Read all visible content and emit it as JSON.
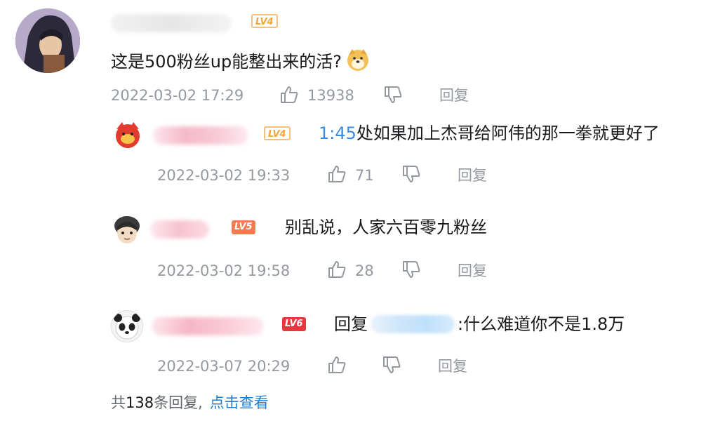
{
  "comment": {
    "level": "LV4",
    "text": "这是500粉丝up能整出来的活?",
    "timestamp": "2022-03-02 17:29",
    "likes": "13938",
    "reply_label": "回复"
  },
  "replies": [
    {
      "level": "LV4",
      "time_link": "1:45",
      "text": "处如果加上杰哥给阿伟的那一拳就更好了",
      "timestamp": "2022-03-02 19:33",
      "likes": "71",
      "reply_label": "回复"
    },
    {
      "level": "LV5",
      "text": "别乱说，人家六百零九粉丝",
      "timestamp": "2022-03-02 19:58",
      "likes": "28",
      "reply_label": "回复"
    },
    {
      "level": "LV6",
      "prefix": "回复",
      "text": ":什么难道你不是1.8万",
      "timestamp": "2022-03-07 20:29",
      "likes": "",
      "reply_label": "回复"
    }
  ],
  "footer": {
    "prefix": "共",
    "count": "138",
    "suffix": "条回复,",
    "link": "点击查看"
  },
  "colors": {
    "meta": "#9499a0",
    "link": "#1e7ed6",
    "lv4": "#f3a43b",
    "lv5": "#f47b4f",
    "lv6": "#e8373f"
  }
}
